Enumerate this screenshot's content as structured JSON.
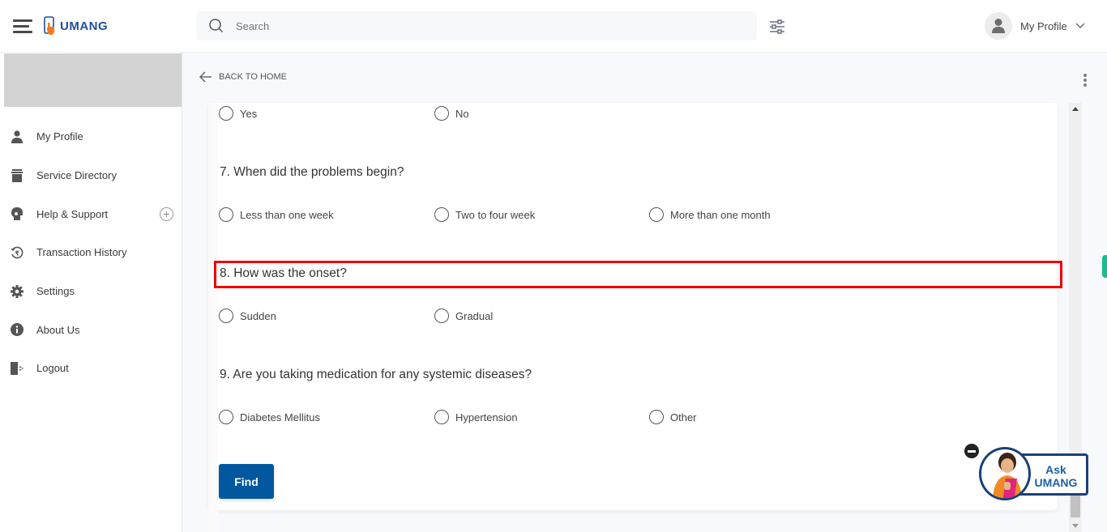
{
  "header": {
    "app_name": "UMANG",
    "search_placeholder": "Search",
    "profile_label": "My Profile"
  },
  "sidebar": {
    "items": [
      {
        "label": "My Profile",
        "icon": "user-icon"
      },
      {
        "label": "Service Directory",
        "icon": "directory-icon"
      },
      {
        "label": "Help & Support",
        "icon": "help-icon",
        "expandable": true
      },
      {
        "label": "Transaction History",
        "icon": "rupee-history-icon"
      },
      {
        "label": "Settings",
        "icon": "gear-icon"
      },
      {
        "label": "About Us",
        "icon": "info-icon"
      },
      {
        "label": "Logout",
        "icon": "logout-icon"
      }
    ]
  },
  "main": {
    "back_label": "BACK TO HOME",
    "prev_options": [
      "Yes",
      "No"
    ],
    "questions": [
      {
        "text": "7. When did the problems begin?",
        "options": [
          "Less than one week",
          "Two to four week",
          "More than one month"
        ]
      },
      {
        "text": "8. How was the onset?",
        "options": [
          "Sudden",
          "Gradual"
        ],
        "highlighted": true
      },
      {
        "text": "9. Are you taking medication for any systemic diseases?",
        "options": [
          "Diabetes Mellitus",
          "Hypertension",
          "Other"
        ]
      }
    ],
    "find_label": "Find"
  },
  "assistant": {
    "line1": "Ask",
    "line2": "UMANG"
  },
  "colors": {
    "brand": "#1f4e9c",
    "button": "#02589f",
    "highlight": "#ee0000",
    "accent_tab": "#12c08f"
  }
}
